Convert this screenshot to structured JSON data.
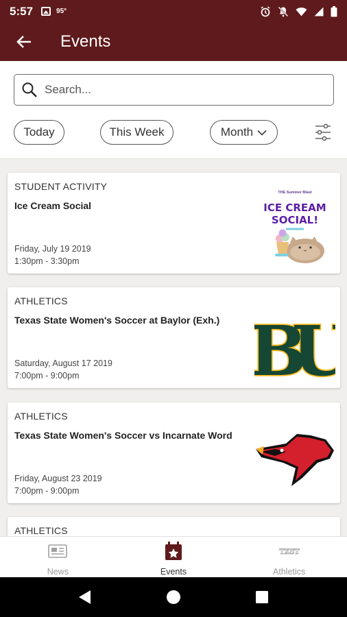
{
  "status_bar": {
    "time": "5:57",
    "temp": "95°"
  },
  "header": {
    "title": "Events"
  },
  "search": {
    "placeholder": "Search..."
  },
  "filters": {
    "today": "Today",
    "this_week": "This Week",
    "month": "Month"
  },
  "events": [
    {
      "category": "STUDENT ACTIVITY",
      "title": "Ice Cream Social",
      "date": "Friday, July 19 2019",
      "time": "1:30pm - 3:30pm",
      "image": {
        "kicker": "THE Summer Blast",
        "headline_1": "ICE CREAM",
        "headline_2": "SOCIAL!"
      }
    },
    {
      "category": "ATHLETICS",
      "title": "Texas State Women's Soccer at Baylor (Exh.)",
      "date": "Saturday, August 17 2019",
      "time": "7:00pm - 9:00pm",
      "image": {
        "logo_text": "BU"
      }
    },
    {
      "category": "ATHLETICS",
      "title": "Texas State Women's Soccer vs Incarnate Word",
      "date": "Friday, August 23 2019",
      "time": "7:00pm - 9:00pm"
    },
    {
      "category": "ATHLETICS"
    }
  ],
  "bottom_nav": [
    {
      "label": "News",
      "icon": "news-icon"
    },
    {
      "label": "Events",
      "icon": "calendar-star-icon",
      "active": true
    },
    {
      "label": "Athletics",
      "icon": "txst-logo-icon",
      "icon_text": "TXST"
    }
  ],
  "colors": {
    "brand": "#5e1a1c",
    "baylor_green": "#154734",
    "baylor_gold": "#ffb81c",
    "cardinal_red": "#d4202c"
  }
}
